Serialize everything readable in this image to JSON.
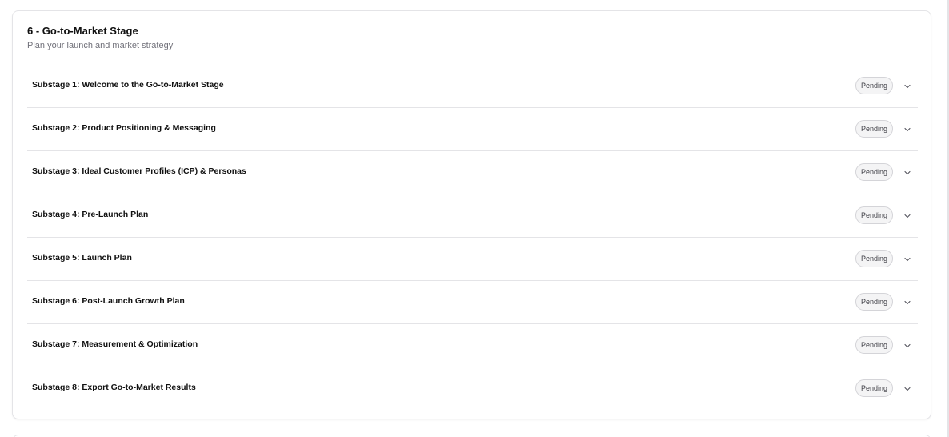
{
  "stage": {
    "title": "6 - Go-to-Market Stage",
    "subtitle": "Plan your launch and market strategy",
    "substages": [
      {
        "title": "Substage 1: Welcome to the Go-to-Market Stage",
        "status": "Pending"
      },
      {
        "title": "Substage 2: Product Positioning & Messaging",
        "status": "Pending"
      },
      {
        "title": "Substage 3: Ideal Customer Profiles (ICP) & Personas",
        "status": "Pending"
      },
      {
        "title": "Substage 4: Pre-Launch Plan",
        "status": "Pending"
      },
      {
        "title": "Substage 5: Launch Plan",
        "status": "Pending"
      },
      {
        "title": "Substage 6: Post-Launch Growth Plan",
        "status": "Pending"
      },
      {
        "title": "Substage 7: Measurement & Optimization",
        "status": "Pending"
      },
      {
        "title": "Substage 8: Export Go-to-Market Results",
        "status": "Pending"
      }
    ]
  },
  "icons": {
    "expand": "chevron-down-icon"
  },
  "colors": {
    "border": "#e4e4e7",
    "badge_bg": "#f4f4f5",
    "badge_border": "#d4d4d8",
    "text": "#111111",
    "muted": "#71717a"
  }
}
